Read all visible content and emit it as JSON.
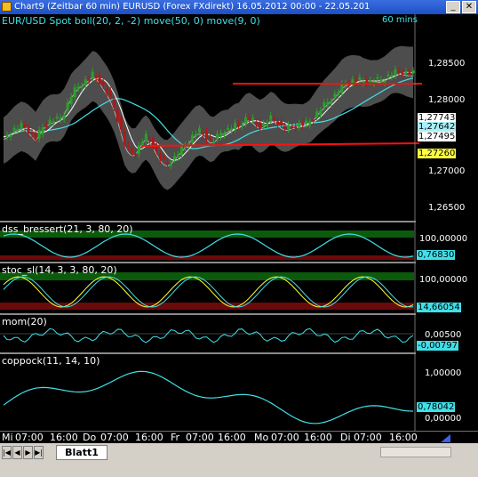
{
  "window": {
    "title": "Chart9 (Zeitbar 60 min)  EURUSD (Forex FXdirekt) 16.05.2012 00:00 - 22.05.201...",
    "minimize_label": "_",
    "close_label": "✕"
  },
  "main_panel": {
    "label": "EUR/USD Spot  boll(20, 2, -2) move(50, 0) move(9, 0)",
    "timeframe": "60 mins",
    "y_ticks": [
      "1,28500",
      "1,28000",
      "1,27000",
      "1,26500"
    ],
    "tags": [
      {
        "text": "1,27743",
        "color": "#ffffff"
      },
      {
        "text": "1,27642",
        "color": "#a8f0f8"
      },
      {
        "text": "1,27495",
        "color": "#ffffff"
      },
      {
        "text": "1,27260",
        "color": "#ffff40"
      }
    ]
  },
  "panels": [
    {
      "label": "dss_bressert(21, 3, 80, 20)",
      "top_tick": "100,00000",
      "tag": "0,76830"
    },
    {
      "label": "stoc_sl(14, 3, 3, 80, 20)",
      "top_tick": "100,00000",
      "tag": "14,66054"
    },
    {
      "label": "mom(20)",
      "top_tick": "0,00500",
      "tag": "-0,00797"
    },
    {
      "label": "coppock(11, 14, 10)",
      "top_tick": "1,00000",
      "mid_tick": "0,00000",
      "tag": "0,78042"
    }
  ],
  "x_axis": [
    "Mi",
    "07:00",
    "16:00",
    "Do",
    "07:00",
    "16:00",
    "Fr",
    "07:00",
    "16:00",
    "Mo",
    "07:00",
    "16:00",
    "Di",
    "07:00",
    "16:00"
  ],
  "sheet_tab": "Blatt1",
  "colors": {
    "band": "#5a5a5a",
    "up": "#2aa02a",
    "down": "#b01818",
    "cyan": "#40e0e8",
    "resistance": "#ff1010"
  }
}
